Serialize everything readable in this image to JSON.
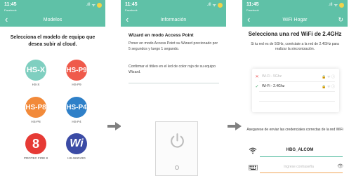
{
  "status": {
    "time": "11:45",
    "carrier": "Facebook",
    "signal": ".ıll",
    "wifi": "ᯤ"
  },
  "screen1": {
    "title": "Modelos",
    "heading": "Selecciona el modelo de equipo que desea subir al cloud.",
    "models": [
      {
        "logo": "HS-X",
        "label": "HS-X",
        "color": "#7fcfc0"
      },
      {
        "logo": "HS-P9",
        "label": "HS-P9",
        "color": "#ef5a4b"
      },
      {
        "logo": "HS-P8",
        "label": "HS-P8",
        "color": "#f28a3a"
      },
      {
        "logo": "HS-P4",
        "label": "HS-P4",
        "color": "#2f80c8"
      },
      {
        "logo": "8",
        "label": "PROTEC FIRE 8",
        "color": "#e63a35"
      },
      {
        "logo": "Wi",
        "label": "HS-WIZARD",
        "color": "#3b4ba5"
      }
    ]
  },
  "screen2": {
    "title": "Información",
    "heading": "Wizard en modo Access Point",
    "text1": "Poner en modo Access Point su Wizard precionado por 5 segundos y luego 1 segundo.",
    "text2": "Confirmar el titileo en el led de color rojo de su equipo Wizard."
  },
  "screen3": {
    "title": "WiFi Hogar",
    "heading": "Selecciona una red WiFi de 2.4GHz",
    "subtext": "Si tu red es de 5GHz, conéctate a la red de 2.4GHz para realizar la sincronización.",
    "networks": [
      {
        "name": "Wi-Fi - 5Ghz",
        "mark": "✕"
      },
      {
        "name": "Wi-Fi - 2.4Ghz",
        "mark": "✓"
      }
    ],
    "note": "Asegurese de enviar las credenciales correctas de la red WiFi",
    "ssid": "HBG_ALCOM",
    "password_placeholder": "Ingrese contraseña"
  },
  "colors": {
    "header": "#5fc1a7",
    "accent_orange": "#f2a65a",
    "arrow": "#808080"
  }
}
